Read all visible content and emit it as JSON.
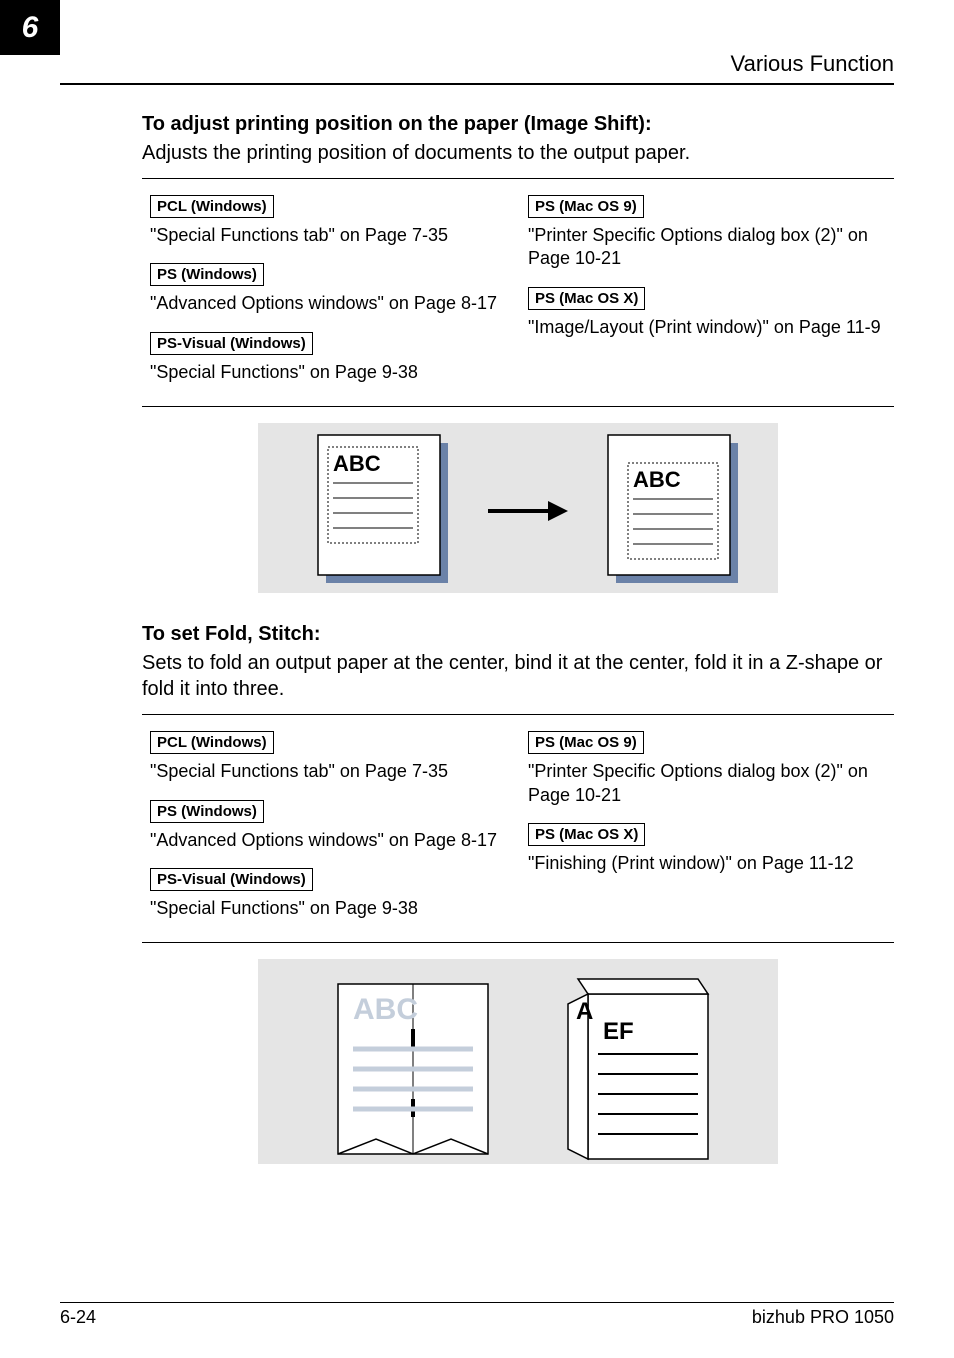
{
  "header": {
    "chapter_number": "6",
    "section_title": "Various Function"
  },
  "section1": {
    "heading": "To adjust printing position on the paper (Image Shift):",
    "desc": "Adjusts the printing position of documents to the output paper.",
    "left": [
      {
        "tag": "PCL (Windows)",
        "link": "\"Special Functions tab\" on Page 7-35"
      },
      {
        "tag": "PS (Windows)",
        "link": "\"Advanced Options windows\" on Page 8-17"
      },
      {
        "tag": "PS-Visual (Windows)",
        "link": "\"Special Functions\" on Page 9-38"
      }
    ],
    "right": [
      {
        "tag": "PS (Mac OS 9)",
        "link": "\"Printer Specific Options dialog box (2)\" on Page 10-21"
      },
      {
        "tag": "PS (Mac OS X)",
        "link": "\"Image/Layout (Print window)\" on Page 11-9"
      }
    ],
    "illus_label_a": "ABC",
    "illus_label_b": "ABC"
  },
  "section2": {
    "heading": "To set Fold, Stitch:",
    "desc": "Sets to fold an output paper at the center, bind it at the center, fold it in a Z-shape or fold it into three.",
    "left": [
      {
        "tag": "PCL (Windows)",
        "link": "\"Special Functions tab\" on Page 7-35"
      },
      {
        "tag": "PS (Windows)",
        "link": "\"Advanced Options windows\" on Page 8-17"
      },
      {
        "tag": "PS-Visual (Windows)",
        "link": "\"Special Functions\" on Page 9-38"
      }
    ],
    "right": [
      {
        "tag": "PS (Mac OS 9)",
        "link": "\"Printer Specific Options dialog box (2)\" on Page 10-21"
      },
      {
        "tag": "PS (Mac OS X)",
        "link": "\"Finishing (Print window)\" on Page 11-12"
      }
    ],
    "illus_labels": {
      "abc": "ABC",
      "ef": "EF",
      "a": "A"
    }
  },
  "footer": {
    "page": "6-24",
    "model": "bizhub PRO 1050"
  }
}
